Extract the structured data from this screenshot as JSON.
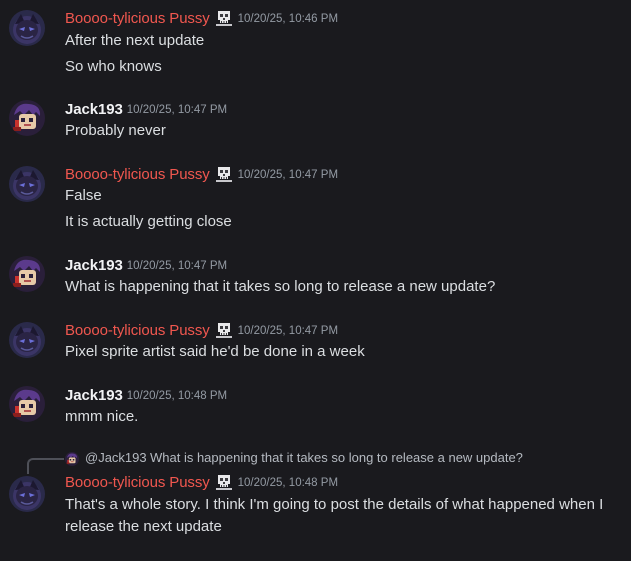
{
  "colors": {
    "background": "#1a1a1e",
    "booo_name": "#f0574f",
    "jack_name": "#f2f3f5",
    "message_text": "#dbdee1",
    "timestamp": "#949ba4"
  },
  "messages": [
    {
      "author": "Boooo-tylicious Pussy",
      "timestamp": "10/20/25, 10:46 PM",
      "lines": [
        "After the next update",
        "So who knows"
      ]
    },
    {
      "author": "Jack193",
      "timestamp": "10/20/25, 10:47 PM",
      "lines": [
        "Probably never"
      ]
    },
    {
      "author": "Boooo-tylicious Pussy",
      "timestamp": "10/20/25, 10:47 PM",
      "lines": [
        "False",
        "It is actually getting close"
      ]
    },
    {
      "author": "Jack193",
      "timestamp": "10/20/25, 10:47 PM",
      "lines": [
        "What is happening that it takes so long to release a new update?"
      ]
    },
    {
      "author": "Boooo-tylicious Pussy",
      "timestamp": "10/20/25, 10:47 PM",
      "lines": [
        "Pixel sprite artist said he'd be done in a week"
      ]
    },
    {
      "author": "Jack193",
      "timestamp": "10/20/25, 10:48 PM",
      "lines": [
        "mmm nice."
      ]
    },
    {
      "author": "Boooo-tylicious Pussy",
      "timestamp": "10/20/25, 10:48 PM",
      "reply": {
        "mention": "@Jack193",
        "text": "What is happening that it takes so long to release a new update?"
      },
      "lines": [
        "That's a whole story. I think I'm going to post the details of what happened when I release the next update"
      ]
    }
  ]
}
